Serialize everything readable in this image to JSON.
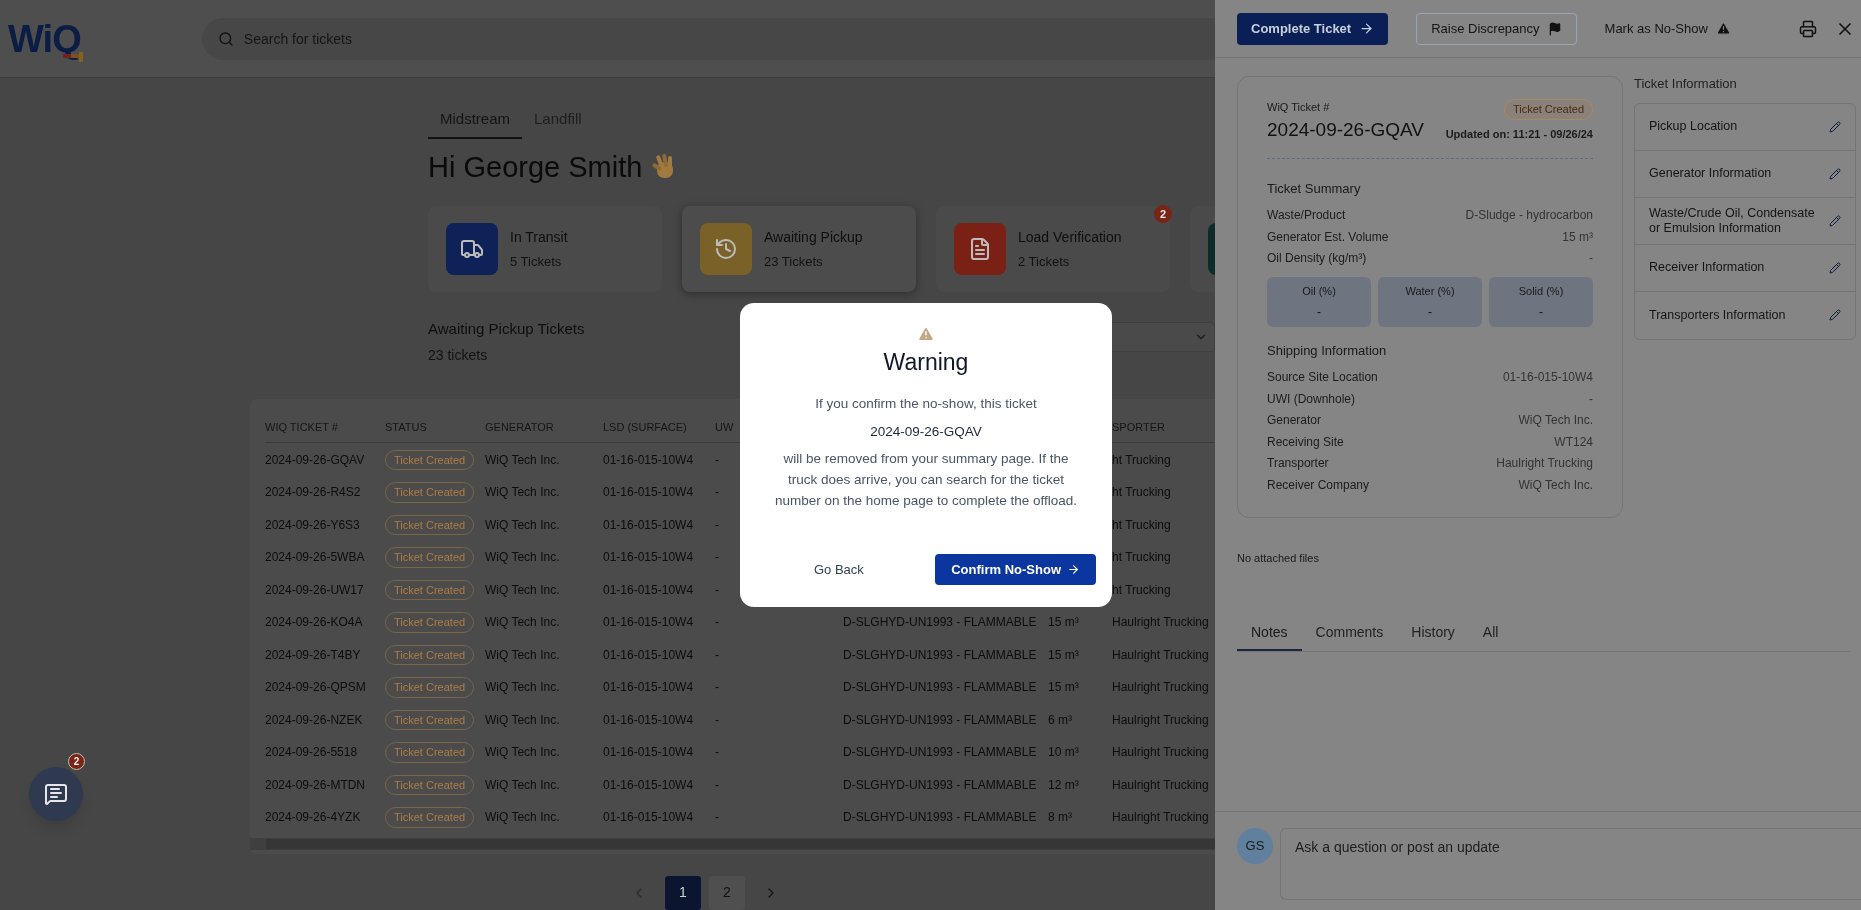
{
  "logo": "WiQ",
  "search": {
    "placeholder": "Search for tickets"
  },
  "site_tabs": [
    {
      "label": "Midstream",
      "selected": true
    },
    {
      "label": "Landfill",
      "selected": false
    }
  ],
  "greeting": "Hi George Smith",
  "summary_cards": [
    {
      "kind": "transit",
      "title": "In Transit",
      "count": "5 Tickets",
      "color": "#0f2257",
      "selected": false
    },
    {
      "kind": "pickup",
      "title": "Awaiting Pickup",
      "count": "23 Tickets",
      "color": "#7a6128",
      "selected": true
    },
    {
      "kind": "verification",
      "title": "Load Verification",
      "count": "2 Tickets",
      "color": "#7a2014",
      "badge": "2",
      "selected": false
    },
    {
      "kind": "other",
      "color": "#0e2b2a"
    }
  ],
  "list": {
    "title": "Awaiting Pickup Tickets",
    "subtitle": "23 tickets"
  },
  "table": {
    "columns": {
      "ticket": "WIQ TICKET #",
      "status": "STATUS",
      "generator": "GENERATOR",
      "lsd": "LSD (SURFACE)",
      "uwi": "UW",
      "transporter": "SPORTER"
    },
    "rows": [
      {
        "ticket": "2024-09-26-GQAV",
        "status": "Ticket Created",
        "generator": "WiQ Tech Inc.",
        "lsd": "01-16-015-10W4",
        "uwi": "-",
        "transporter": "ht Trucking"
      },
      {
        "ticket": "2024-09-26-R4S2",
        "status": "Ticket Created",
        "generator": "WiQ Tech Inc.",
        "lsd": "01-16-015-10W4",
        "uwi": "-",
        "transporter": "ht Trucking"
      },
      {
        "ticket": "2024-09-26-Y6S3",
        "status": "Ticket Created",
        "generator": "WiQ Tech Inc.",
        "lsd": "01-16-015-10W4",
        "uwi": "-",
        "transporter": "ht Trucking"
      },
      {
        "ticket": "2024-09-26-5WBA",
        "status": "Ticket Created",
        "generator": "WiQ Tech Inc.",
        "lsd": "01-16-015-10W4",
        "uwi": "-",
        "transporter": "ht Trucking"
      },
      {
        "ticket": "2024-09-26-UW17",
        "status": "Ticket Created",
        "generator": "WiQ Tech Inc.",
        "lsd": "01-16-015-10W4",
        "uwi": "-",
        "transporter": "ht Trucking"
      },
      {
        "ticket": "2024-09-26-KO4A",
        "status": "Ticket Created",
        "generator": "WiQ Tech Inc.",
        "lsd": "01-16-015-10W4",
        "uwi": "-",
        "product": "D-SLGHYD-UN1993 - FLAMMABLE",
        "volume": "15 m³",
        "transporter": "Haulright Trucking"
      },
      {
        "ticket": "2024-09-26-T4BY",
        "status": "Ticket Created",
        "generator": "WiQ Tech Inc.",
        "lsd": "01-16-015-10W4",
        "uwi": "-",
        "product": "D-SLGHYD-UN1993 - FLAMMABLE",
        "volume": "15 m³",
        "transporter": "Haulright Trucking"
      },
      {
        "ticket": "2024-09-26-QPSM",
        "status": "Ticket Created",
        "generator": "WiQ Tech Inc.",
        "lsd": "01-16-015-10W4",
        "uwi": "-",
        "product": "D-SLGHYD-UN1993 - FLAMMABLE",
        "volume": "15 m³",
        "transporter": "Haulright Trucking"
      },
      {
        "ticket": "2024-09-26-NZEK",
        "status": "Ticket Created",
        "generator": "WiQ Tech Inc.",
        "lsd": "01-16-015-10W4",
        "uwi": "-",
        "product": "D-SLGHYD-UN1993 - FLAMMABLE",
        "volume": "6 m³",
        "transporter": "Haulright Trucking"
      },
      {
        "ticket": "2024-09-26-5518",
        "status": "Ticket Created",
        "generator": "WiQ Tech Inc.",
        "lsd": "01-16-015-10W4",
        "uwi": "-",
        "product": "D-SLGHYD-UN1993 - FLAMMABLE",
        "volume": "10 m³",
        "transporter": "Haulright Trucking"
      },
      {
        "ticket": "2024-09-26-MTDN",
        "status": "Ticket Created",
        "generator": "WiQ Tech Inc.",
        "lsd": "01-16-015-10W4",
        "uwi": "-",
        "product": "D-SLGHYD-UN1993 - FLAMMABLE",
        "volume": "12 m³",
        "transporter": "Haulright Trucking"
      },
      {
        "ticket": "2024-09-26-4YZK",
        "status": "Ticket Created",
        "generator": "WiQ Tech Inc.",
        "lsd": "01-16-015-10W4",
        "uwi": "-",
        "product": "D-SLGHYD-UN1993 - FLAMMABLE",
        "volume": "8 m³",
        "transporter": "Haulright Trucking"
      }
    ]
  },
  "pagination": {
    "pages": [
      {
        "label": "1",
        "selected": true
      },
      {
        "label": "2",
        "selected": false
      }
    ]
  },
  "chat": {
    "badge": "2"
  },
  "drawer": {
    "actions": [
      {
        "kind": "primary",
        "label": "Complete Ticket"
      },
      {
        "kind": "outline",
        "label": "Raise Discrepancy"
      },
      {
        "kind": "plain",
        "label": "Mark as No-Show"
      }
    ],
    "ticket": {
      "label": "WiQ Ticket #",
      "number": "2024-09-26-GQAV",
      "status": "Ticket Created",
      "updated": "Updated on: 11:21 - 09/26/24",
      "summary": {
        "title": "Ticket Summary",
        "fields": [
          {
            "label": "Waste/Product",
            "value": "D-Sludge - hydrocarbon"
          },
          {
            "label": "Generator Est. Volume",
            "value": "15 m³"
          },
          {
            "label": "Oil Density (kg/m³)",
            "value": "-"
          }
        ]
      },
      "composition": [
        {
          "label": "Oil (%)",
          "value": "-"
        },
        {
          "label": "Water (%)",
          "value": "-"
        },
        {
          "label": "Solid (%)",
          "value": "-"
        }
      ],
      "shipping": {
        "title": "Shipping Information",
        "fields": [
          {
            "label": "Source Site Location",
            "value": "01-16-015-10W4"
          },
          {
            "label": "UWI (Downhole)",
            "value": "-"
          },
          {
            "label": "Generator",
            "value": "WiQ Tech Inc."
          },
          {
            "label": "Receiving Site",
            "value": "WT124"
          },
          {
            "label": "Transporter",
            "value": "Haulright Trucking"
          },
          {
            "label": "Receiver Company",
            "value": "WiQ Tech Inc."
          }
        ]
      }
    },
    "info": {
      "title": "Ticket Information",
      "items": [
        "Pickup Location",
        "Generator Information",
        "Waste/Crude Oil, Condensate or Emulsion Information",
        "Receiver Information",
        "Transporters Information"
      ]
    },
    "files_note": "No attached files",
    "activity_tabs": [
      {
        "label": "Notes",
        "selected": true
      },
      {
        "label": "Comments",
        "selected": false
      },
      {
        "label": "History",
        "selected": false
      },
      {
        "label": "All",
        "selected": false
      }
    ],
    "comment": {
      "avatar": "GS",
      "placeholder": "Ask a question or post an update"
    }
  },
  "modal": {
    "title": "Warning",
    "intro": "If you confirm the no-show, this ticket",
    "ticket": "2024-09-26-GQAV",
    "body": "will be removed from your summary page. If the truck does arrive, you can search for the ticket number on the home page to complete the offload.",
    "buttons": [
      {
        "kind": "secondary",
        "label": "Go Back"
      },
      {
        "kind": "primary",
        "label": "Confirm No-Show"
      }
    ]
  }
}
